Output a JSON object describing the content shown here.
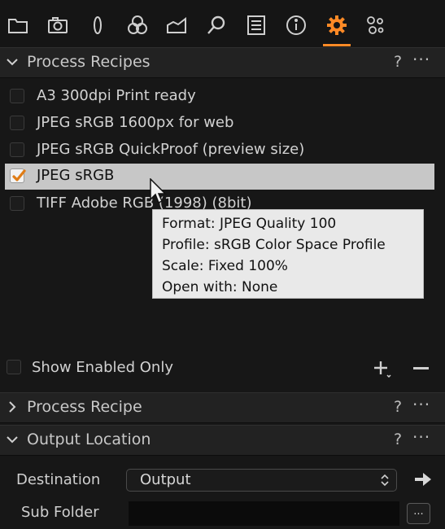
{
  "toolbar": {
    "tabs": [
      {
        "name": "library-tab",
        "icon": "folder-icon"
      },
      {
        "name": "capture-tab",
        "icon": "camera-icon"
      },
      {
        "name": "lens-tab",
        "icon": "lens-icon"
      },
      {
        "name": "color-tab",
        "icon": "color-circles-icon"
      },
      {
        "name": "exposure-tab",
        "icon": "exposure-icon"
      },
      {
        "name": "details-tab",
        "icon": "magnifier-icon"
      },
      {
        "name": "metadata-tab",
        "icon": "metadata-list-icon"
      },
      {
        "name": "info-tab",
        "icon": "info-icon"
      },
      {
        "name": "output-tab",
        "icon": "gear-icon",
        "active": true
      },
      {
        "name": "batch-tab",
        "icon": "gears-icon"
      }
    ],
    "accent_color": "#ff8a26"
  },
  "process_recipes": {
    "title": "Process Recipes",
    "help": "?",
    "more": "···",
    "recipes": [
      {
        "label": "A3 300dpi Print ready",
        "checked": false
      },
      {
        "label": "JPEG sRGB 1600px for web",
        "checked": false
      },
      {
        "label": "JPEG sRGB QuickProof (preview size)",
        "checked": false
      },
      {
        "label": "JPEG sRGB",
        "checked": true,
        "selected": true
      },
      {
        "label": "TIFF Adobe RGB (1998) (8bit)",
        "checked": false
      }
    ],
    "tooltip": {
      "format": "Format: JPEG Quality 100",
      "profile": "Profile: sRGB Color Space Profile",
      "scale": "Scale: Fixed 100%",
      "open_with": "Open with: None"
    },
    "show_enabled_only": {
      "label": "Show Enabled Only",
      "checked": false
    },
    "add_icon": "plus-icon",
    "remove_icon": "minus-icon"
  },
  "process_recipe": {
    "title": "Process Recipe",
    "help": "?",
    "more": "···"
  },
  "output_location": {
    "title": "Output Location",
    "help": "?",
    "more": "···",
    "destination_label": "Destination",
    "destination_value": "Output",
    "subfolder_label": "Sub Folder",
    "subfolder_value": "",
    "browse_label": "..."
  }
}
